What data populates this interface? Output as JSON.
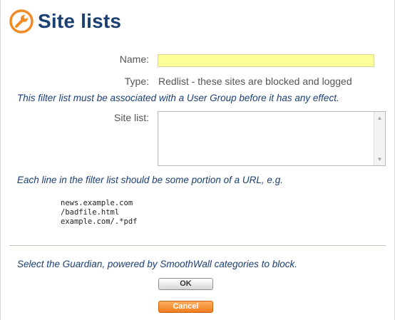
{
  "header": {
    "title": "Site lists",
    "icon": "wrench-icon",
    "icon_color": "#f08a24"
  },
  "form": {
    "name_label": "Name:",
    "name_value": "",
    "type_label": "Type:",
    "type_value": "Redlist - these sites are blocked and logged",
    "association_note": "This filter list must be associated with a User Group before it has any effect.",
    "site_list_label": "Site list:",
    "site_list_value": "",
    "url_hint": "Each line in the filter list should be some portion of a URL, e.g.",
    "examples": [
      "news.example.com",
      "/badfile.html",
      "example.com/.*pdf"
    ],
    "categories_note": "Select the Guardian, powered by SmoothWall categories to block."
  },
  "buttons": {
    "ok_label": "OK",
    "cancel_label": "Cancel"
  },
  "colors": {
    "title": "#1b3f73",
    "name_field_bg": "#ffff99",
    "cancel_bg": "#f07c1e"
  }
}
